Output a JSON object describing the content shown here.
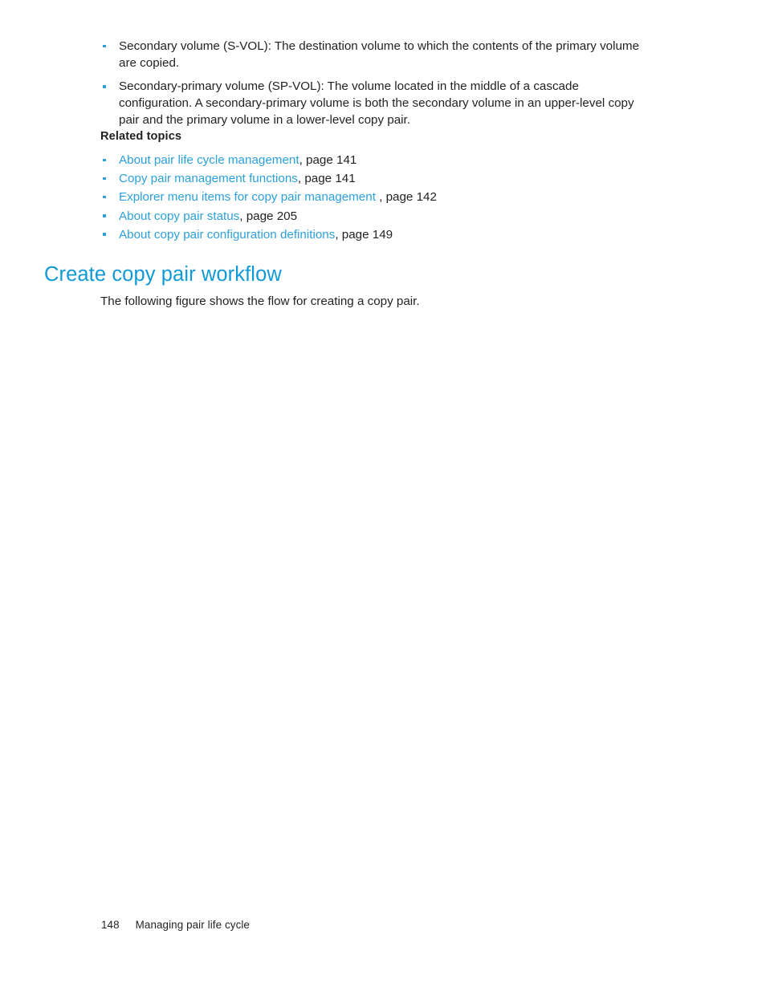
{
  "page": {
    "background_color": "#ffffff",
    "text_color": "#231f20",
    "accent_heading_color": "#0f9ad7",
    "link_color": "#2ba0da",
    "bullet_color": "#2a9fd8"
  },
  "definitions": {
    "items": [
      {
        "text": "Secondary volume (S-VOL): The destination volume to which the contents of the primary volume are copied."
      },
      {
        "text": "Secondary-primary volume (SP-VOL): The volume located in the middle of a cascade configuration. A secondary-primary volume is both the secondary volume in an upper-level copy pair and the primary volume in a lower-level copy pair."
      }
    ]
  },
  "related_topics": {
    "heading": "Related topics",
    "items": [
      {
        "link": "About pair life cycle management",
        "tail": ", page 141"
      },
      {
        "link": "Copy pair management functions",
        "tail": ", page 141"
      },
      {
        "link": "Explorer menu items for copy pair management",
        "tail": " , page 142"
      },
      {
        "link": "About copy pair status",
        "tail": ", page 205"
      },
      {
        "link": "About copy pair configuration definitions",
        "tail": ", page 149"
      }
    ]
  },
  "section": {
    "heading": "Create copy pair workflow",
    "paragraph": "The following figure shows the flow for creating a copy pair."
  },
  "footer": {
    "page_number": "148",
    "chapter_title": "Managing pair life cycle"
  }
}
